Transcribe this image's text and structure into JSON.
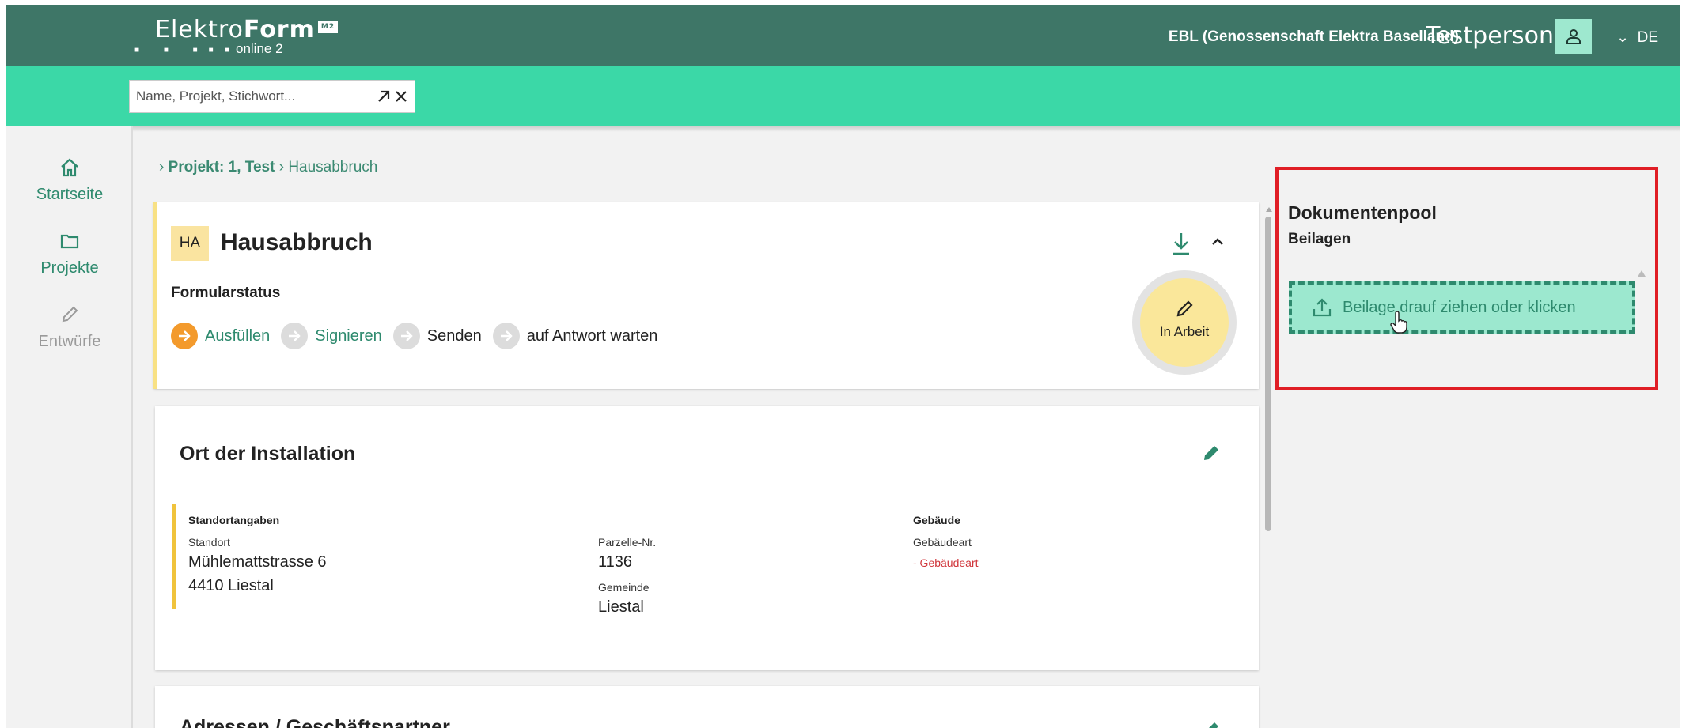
{
  "header": {
    "logo_prefix": "Elektro",
    "logo_bold": "Form",
    "logo_badge": "M2",
    "logo_sub": "online 2",
    "organization": "EBL (Genossenschaft Elektra Baselland)",
    "user_name": "Testperson",
    "language": "DE"
  },
  "search": {
    "placeholder": "Name, Projekt, Stichwort..."
  },
  "sidebar": {
    "items": [
      {
        "label": "Startseite",
        "icon": "home-icon",
        "state": "active"
      },
      {
        "label": "Projekte",
        "icon": "folder-icon",
        "state": "active"
      },
      {
        "label": "Entwürfe",
        "icon": "pencil-icon",
        "state": "disabled"
      }
    ]
  },
  "breadcrumb": {
    "project": "Projekt: 1, Test",
    "current": "Hausabbruch"
  },
  "form_card": {
    "badge": "HA",
    "title": "Hausabbruch",
    "status_heading": "Formularstatus",
    "steps": [
      {
        "label": "Ausfüllen",
        "state": "active"
      },
      {
        "label": "Signieren",
        "state": "next"
      },
      {
        "label": "Senden",
        "state": "pending"
      },
      {
        "label": "auf Antwort warten",
        "state": "pending"
      }
    ],
    "status_badge": "In Arbeit"
  },
  "installation_card": {
    "title": "Ort der Installation",
    "location_heading": "Standortangaben",
    "location_label": "Standort",
    "street": "Mühlemattstrasse  6",
    "city": "4410  Liestal",
    "parcel_label": "Parzelle-Nr.",
    "parcel_value": "1136",
    "municipality_label": "Gemeinde",
    "municipality_value": "Liestal",
    "building_heading": "Gebäude",
    "building_type_label": "Gebäudeart",
    "building_type_missing": "- Gebäudeart"
  },
  "address_card": {
    "title": "Adressen / Geschäftspartner"
  },
  "document_pool": {
    "title": "Dokumentenpool",
    "subtitle": "Beilagen",
    "drop_label": "Beilage drauf ziehen oder klicken"
  },
  "colors": {
    "header_dark": "#3e7667",
    "header_accent": "#3bd8a7",
    "primary": "#2e8a6e",
    "step_active": "#f39a2c",
    "status_yellow": "#fae79a",
    "highlight_red": "#e01e26"
  }
}
